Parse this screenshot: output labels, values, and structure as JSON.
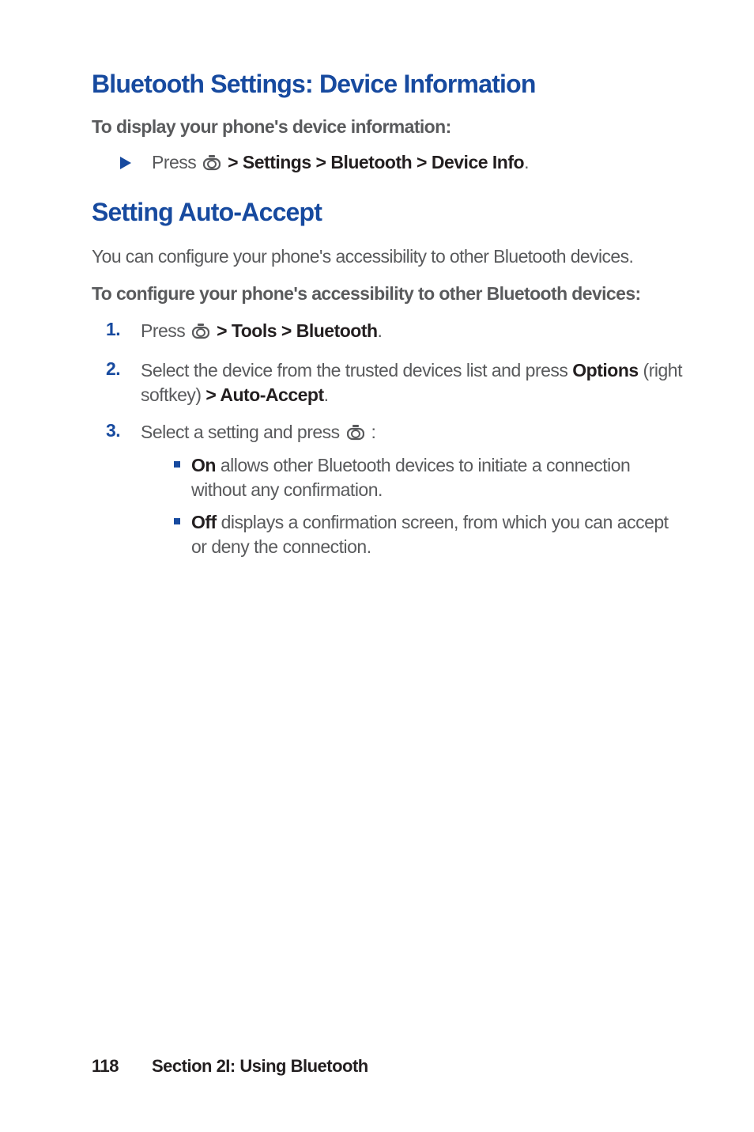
{
  "section1": {
    "heading": "Bluetooth Settings: Device Information",
    "subheading": "To display your phone's device information:",
    "action_prefix": "Press ",
    "action_bold": " > Settings > Bluetooth > Device Info",
    "action_suffix": "."
  },
  "section2": {
    "heading": "Setting Auto-Accept",
    "intro": "You can configure your phone's accessibility to other Bluetooth devices.",
    "subheading": "To configure your phone's accessibility to other Bluetooth devices:",
    "steps": [
      {
        "num": "1.",
        "pre": "Press ",
        "bold1": " > Tools > Bluetooth",
        "suf1": "."
      },
      {
        "num": "2.",
        "pre": "Select the device from the trusted devices list and press ",
        "bold1": "Options",
        "mid": " (right softkey) ",
        "bold2": "> Auto-Accept",
        "suf1": "."
      },
      {
        "num": "3.",
        "pre": "Select a setting and press ",
        "suf1": " :",
        "bullets": [
          {
            "bold": "On",
            "text": " allows other Bluetooth devices to initiate a connection without any confirmation."
          },
          {
            "bold": "Off",
            "text": " displays a confirmation screen, from which you can accept or deny the connection."
          }
        ]
      }
    ]
  },
  "footer": {
    "page": "118",
    "section": "Section 2I: Using Bluetooth"
  }
}
